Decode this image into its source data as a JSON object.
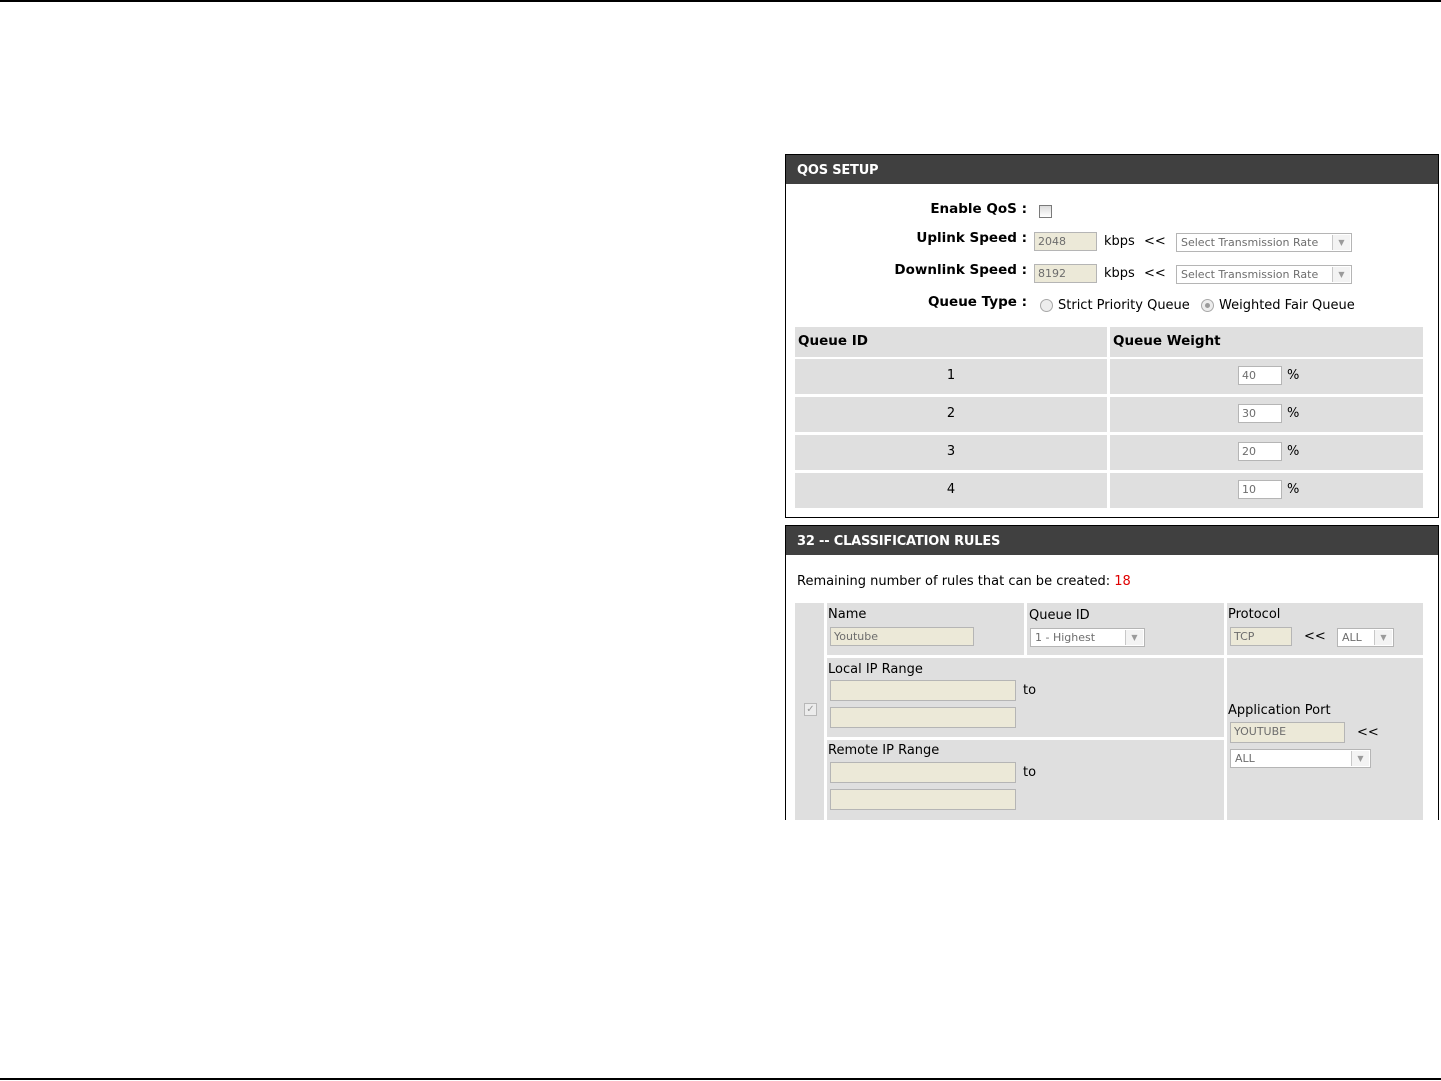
{
  "qos": {
    "title": "QOS SETUP",
    "enable_label": "Enable QoS :",
    "uplink_label": "Uplink Speed :",
    "uplink_value": "2048",
    "downlink_label": "Downlink Speed :",
    "downlink_value": "8192",
    "unit": "kbps",
    "arrows": "<<",
    "rate_placeholder": "Select Transmission Rate",
    "queue_type_label": "Queue Type :",
    "queue_type_options": [
      "Strict Priority Queue",
      "Weighted Fair Queue"
    ],
    "queue_type_selected": "Weighted Fair Queue",
    "enabled": false,
    "table": {
      "headers": [
        "Queue ID",
        "Queue Weight"
      ],
      "percent": "%",
      "rows": [
        {
          "id": "1",
          "weight": "40"
        },
        {
          "id": "2",
          "weight": "30"
        },
        {
          "id": "3",
          "weight": "20"
        },
        {
          "id": "4",
          "weight": "10"
        }
      ]
    }
  },
  "rules": {
    "title": "32 -- CLASSIFICATION RULES",
    "remaining_label": "Remaining number of rules that can be created:",
    "remaining_count": "18",
    "count_color": "#e00000",
    "rule": {
      "checked": true,
      "name_label": "Name",
      "name_value": "Youtube",
      "queue_label": "Queue ID",
      "queue_value": "1 - Highest",
      "protocol_label": "Protocol",
      "protocol_value": "TCP",
      "protocol_select": "ALL",
      "arrows": "<<",
      "local_ip_label": "Local IP Range",
      "remote_ip_label": "Remote IP Range",
      "to": "to",
      "app_port_label": "Application Port",
      "app_port_value": "YOUTUBE",
      "app_port_select": "ALL"
    }
  },
  "colors": {
    "panel_header_bg": "#404040",
    "cell_bg": "#dfdfdf",
    "input_bg": "#ece9d8"
  }
}
